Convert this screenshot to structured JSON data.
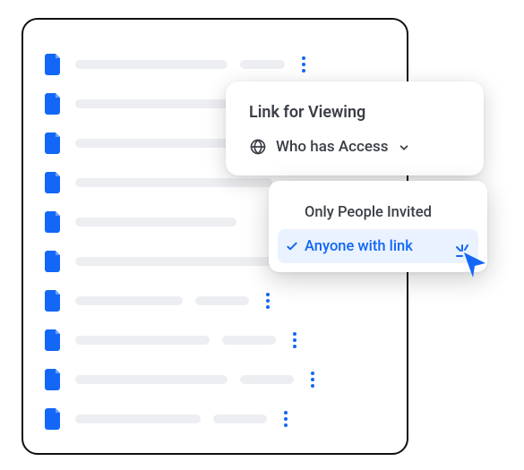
{
  "colors": {
    "accent": "#1267f6",
    "text": "#3b3e46",
    "skeleton": "#edeef1"
  },
  "rows": [
    {
      "skel_main": 170,
      "skel_side": 50,
      "more": true
    },
    {
      "skel_main": 240,
      "skel_side": 50,
      "more": true
    },
    {
      "skel_main": 200,
      "skel_side": 0,
      "more": false
    },
    {
      "skel_main": 220,
      "skel_side": 0,
      "more": false
    },
    {
      "skel_main": 180,
      "skel_side": 0,
      "more": false
    },
    {
      "skel_main": 260,
      "skel_side": 0,
      "more": false
    },
    {
      "skel_main": 120,
      "skel_side": 60,
      "more": true
    },
    {
      "skel_main": 150,
      "skel_side": 60,
      "more": true
    },
    {
      "skel_main": 170,
      "skel_side": 60,
      "more": true
    },
    {
      "skel_main": 140,
      "skel_side": 60,
      "more": true
    }
  ],
  "share": {
    "title": "Link for Viewing",
    "access_label": "Who has Access"
  },
  "options": [
    {
      "label": "Only People Invited",
      "selected": false
    },
    {
      "label": "Anyone with link",
      "selected": true
    }
  ]
}
